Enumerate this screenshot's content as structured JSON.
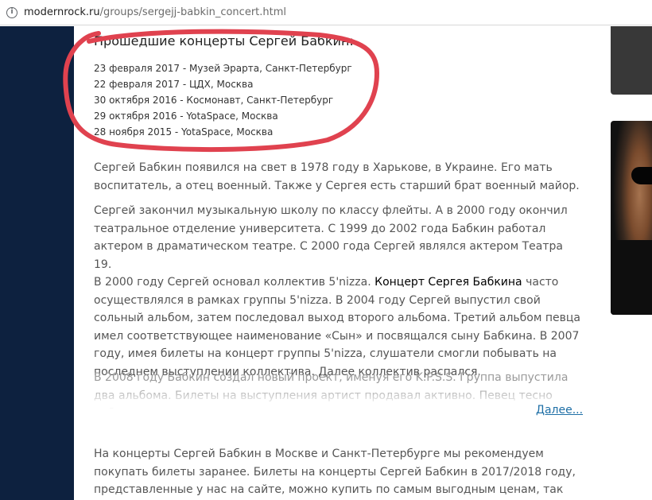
{
  "browser": {
    "url_host": "modernrock.ru",
    "url_path": "/groups/sergejj-babkin_concert.html"
  },
  "past_concerts": {
    "title": "Прошедшие концерты Сергей Бабкин:",
    "items": [
      "23 февраля 2017 - Музей Эрарта, Санкт-Петербург",
      "22 февраля 2017 - ЦДХ, Москва",
      "30 октября 2016 - Космонавт, Санкт-Петербург",
      "29 октября 2016 - YotaSpace, Москва",
      "28 ноября 2015 - YotaSpace, Москва"
    ]
  },
  "bio": {
    "p1": "Сергей Бабкин появился на свет в 1978 году в Харькове, в Украине. Его мать воспитатель, а отец военный. Также у Сергея есть старший брат военный майор.",
    "p2_part1": "Сергей закончил музыкальную школу по классу флейты. А в 2000 году окончил театральное отделение университета. С 1999 до 2002 года Бабкин работал актером в драматическом театре. С 2000 года Сергей являлся актером Театра 19.",
    "p2_part2": "В 2000 году Сергей основал коллектив 5'nizza. ",
    "p2_bold": "Концерт Сергея Бабкина",
    "p2_part3": " часто осуществлялся в рамках группы 5'nizza. В 2004 году Сергей выпустил свой сольный альбом, затем последовал выход второго альбома. Третий альбом певца имел соответствующее наименование «Сын» и посвящался сыну Бабкина. В 2007 году, имея билеты на концерт группы 5'nizza, слушатели смогли побывать на последнем выступлении коллектива. Далее коллектив распался.",
    "p3": "В 2008 году Бабкин создал новый проект, именуя его K.P.S.S. Группа выпустила два альбома. Билеты на выступления артист продавал активно. Певец тесно работал со",
    "more_link": "Далее..."
  },
  "tickets": {
    "p": "На концерты Сергей Бабкин в Москве и Санкт-Петербурге мы рекомендуем покупать билеты заранее. Билеты на концерты Сергей Бабкин в 2017/2018 году, представленные у нас на сайте, можно купить по самым выгодным ценам, так как мы сотрудничаем"
  },
  "colors": {
    "sidebar": "#0d213f",
    "annotation": "#e0424f",
    "link": "#1e6fa6"
  },
  "icons": {
    "address_bar": "info-icon"
  }
}
